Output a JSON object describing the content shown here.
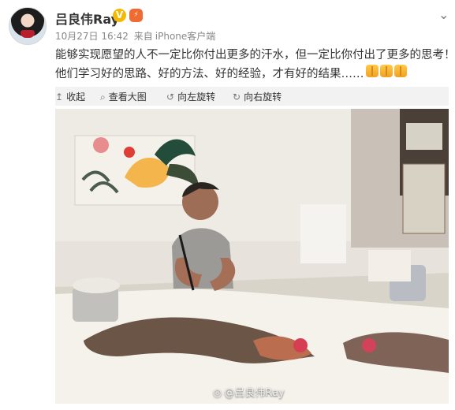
{
  "post": {
    "username": "吕良伟Ray",
    "verified_badge": "V",
    "level_badge": "⚡",
    "timestamp": "10月27日 16:42",
    "source_prefix": "来自",
    "source": "iPhone客户端",
    "text_line1": "能够实现愿望的人不一定比你付出更多的汗水，但一定比你付出了更多的思考！",
    "text_line2": "他们学习好的思路、好的方法、好的经验，才有好的结果……",
    "emoji_count": 3
  },
  "toolbar": {
    "collapse": "收起",
    "view_large": "查看大图",
    "rotate_left": "向左旋转",
    "rotate_right": "向右旋转"
  },
  "photo": {
    "watermark": "@吕良伟Ray"
  },
  "icons": {
    "collapse": "up-arrow-icon",
    "view_large": "magnifier-icon",
    "rotate_left": "rotate-left-icon",
    "rotate_right": "rotate-right-icon",
    "more": "chevron-down-icon"
  },
  "colors": {
    "username": "#333333",
    "meta": "#888888",
    "toolbar_bg": "#f2f2f2"
  }
}
